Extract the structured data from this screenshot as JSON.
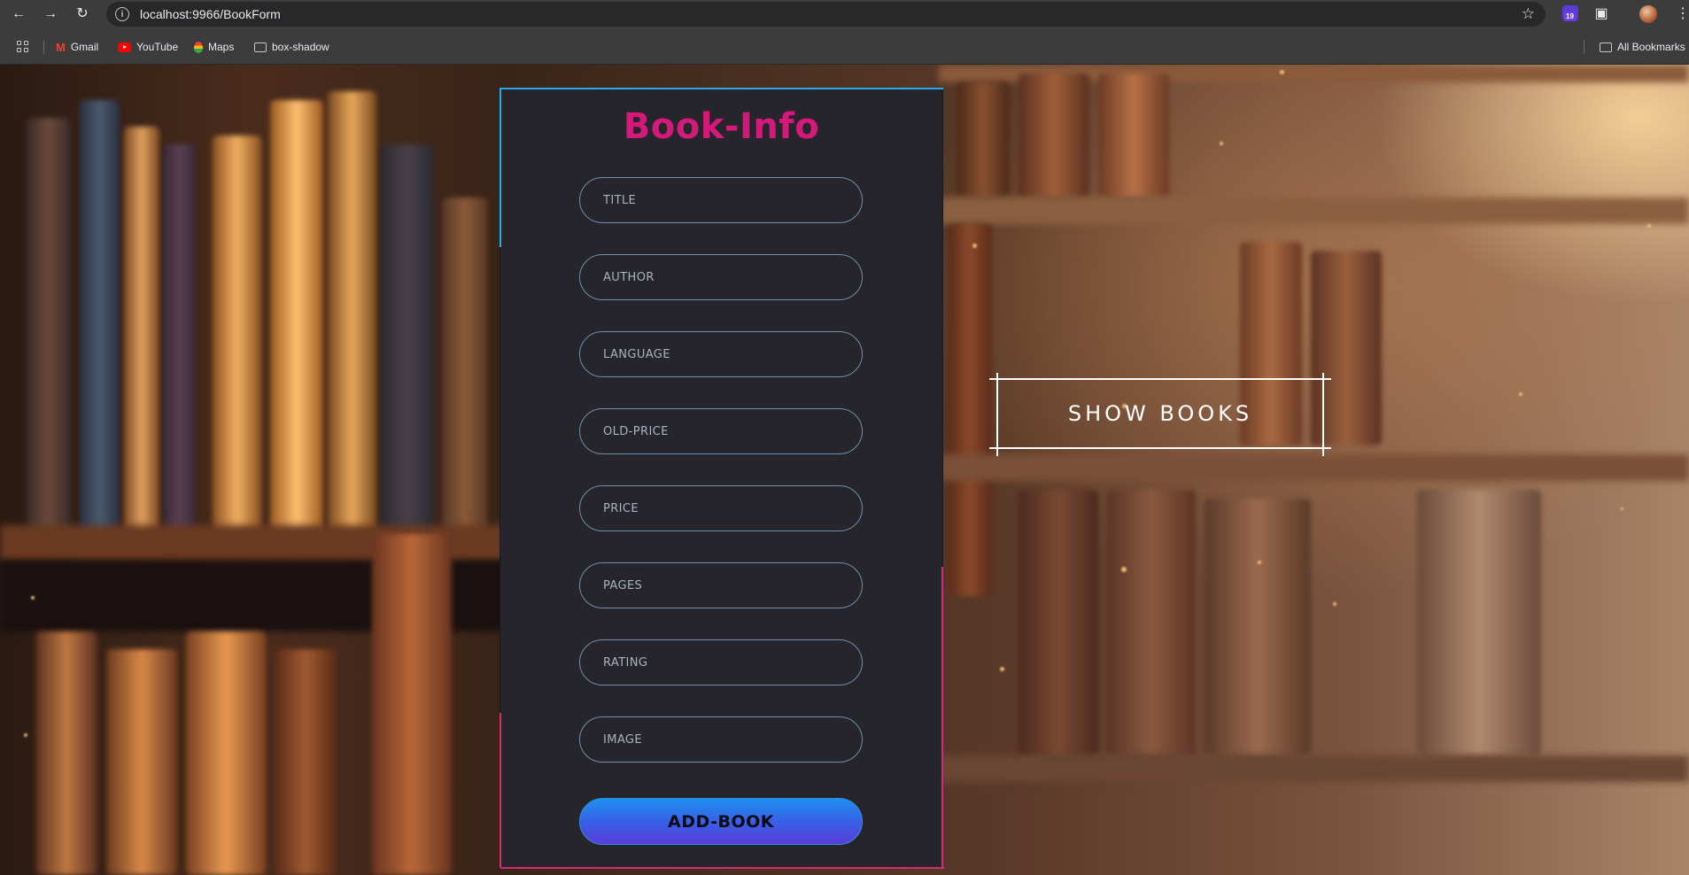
{
  "browser": {
    "url": "localhost:9966/BookForm",
    "extension_badge": "19",
    "bookmarks": [
      {
        "label": "Gmail",
        "icon": "gmail-icon"
      },
      {
        "label": "YouTube",
        "icon": "youtube-icon"
      },
      {
        "label": "Maps",
        "icon": "maps-icon"
      },
      {
        "label": "box-shadow",
        "icon": "folder-icon"
      }
    ],
    "all_bookmarks": "All Bookmarks"
  },
  "form": {
    "title": "Book-Info",
    "fields": [
      {
        "placeholder": "TITLE",
        "value": ""
      },
      {
        "placeholder": "AUTHOR",
        "value": ""
      },
      {
        "placeholder": "LANGUAGE",
        "value": ""
      },
      {
        "placeholder": "OLD-PRICE",
        "value": ""
      },
      {
        "placeholder": "PRICE",
        "value": ""
      },
      {
        "placeholder": "PAGES",
        "value": ""
      },
      {
        "placeholder": "RATING",
        "value": ""
      },
      {
        "placeholder": "IMAGE",
        "value": ""
      }
    ],
    "submit_label": "ADD-BOOK"
  },
  "show_books_label": "SHOW BOOKS",
  "colors": {
    "title": "#d4197a",
    "accent_blue": "#2aa8e8",
    "accent_pink": "#d42a78",
    "card_bg": "#25252b"
  }
}
